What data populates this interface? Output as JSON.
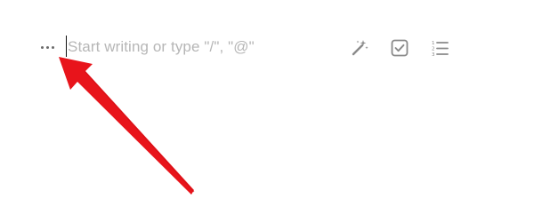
{
  "editor": {
    "placeholder": "Start writing or type \"/\", \"@\"",
    "more_handle_icon": "more-horizontal-icon",
    "toolbar": [
      {
        "icon": "magic-wand-icon"
      },
      {
        "icon": "checkbox-icon"
      },
      {
        "icon": "numbered-list-icon"
      }
    ]
  },
  "annotation": {
    "type": "arrow",
    "color": "#e8141b"
  },
  "colors": {
    "placeholder": "#b6b6b6",
    "icons": "#8a8a8a",
    "accent_arrow": "#e8141b"
  }
}
